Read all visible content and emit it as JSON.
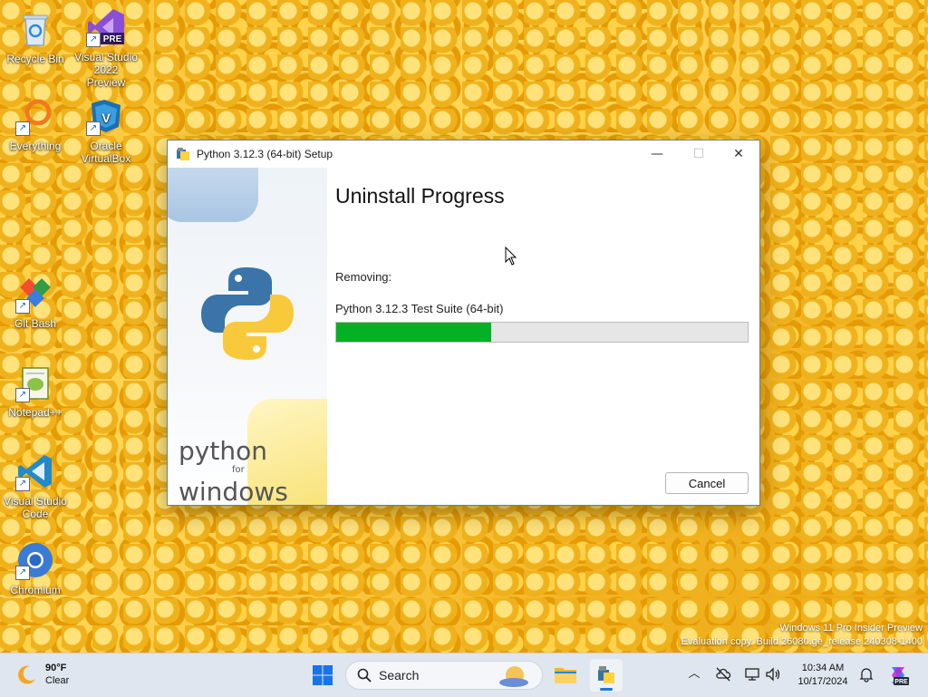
{
  "desktop": {
    "icons": [
      {
        "label": "Recycle Bin"
      },
      {
        "label": "Visual Studio 2022 Preview",
        "badge": "PRE"
      },
      {
        "label": "Everything"
      },
      {
        "label": "Oracle VirtualBox"
      },
      {
        "label": "Git Bash"
      },
      {
        "label": "Notepad++"
      },
      {
        "label": "Visual Studio Code"
      },
      {
        "label": "Chromium"
      }
    ],
    "watermark": {
      "line1": "Windows 11 Pro Insider Preview",
      "line2": "Evaluation copy. Build 26080.ge_release.240308-1400"
    }
  },
  "window": {
    "title": "Python 3.12.3 (64-bit) Setup",
    "controls": {
      "minimize": "—",
      "maximize": "☐",
      "close": "✕"
    },
    "sidebar": {
      "word1": "python",
      "word2": "for",
      "word3": "windows"
    },
    "heading": "Uninstall Progress",
    "status_label": "Removing:",
    "item_label": "Python 3.12.3 Test Suite (64-bit)",
    "progress": 0.377,
    "cancel_label": "Cancel",
    "colors": {
      "progress_fill": "#06b025",
      "progress_track": "#e6e6e6"
    }
  },
  "taskbar": {
    "weather": {
      "temp": "90°F",
      "condition": "Clear"
    },
    "search_placeholder": "Search",
    "clock": {
      "time": "10:34 AM",
      "date": "10/17/2024"
    },
    "copilot_badge": "PRE"
  }
}
